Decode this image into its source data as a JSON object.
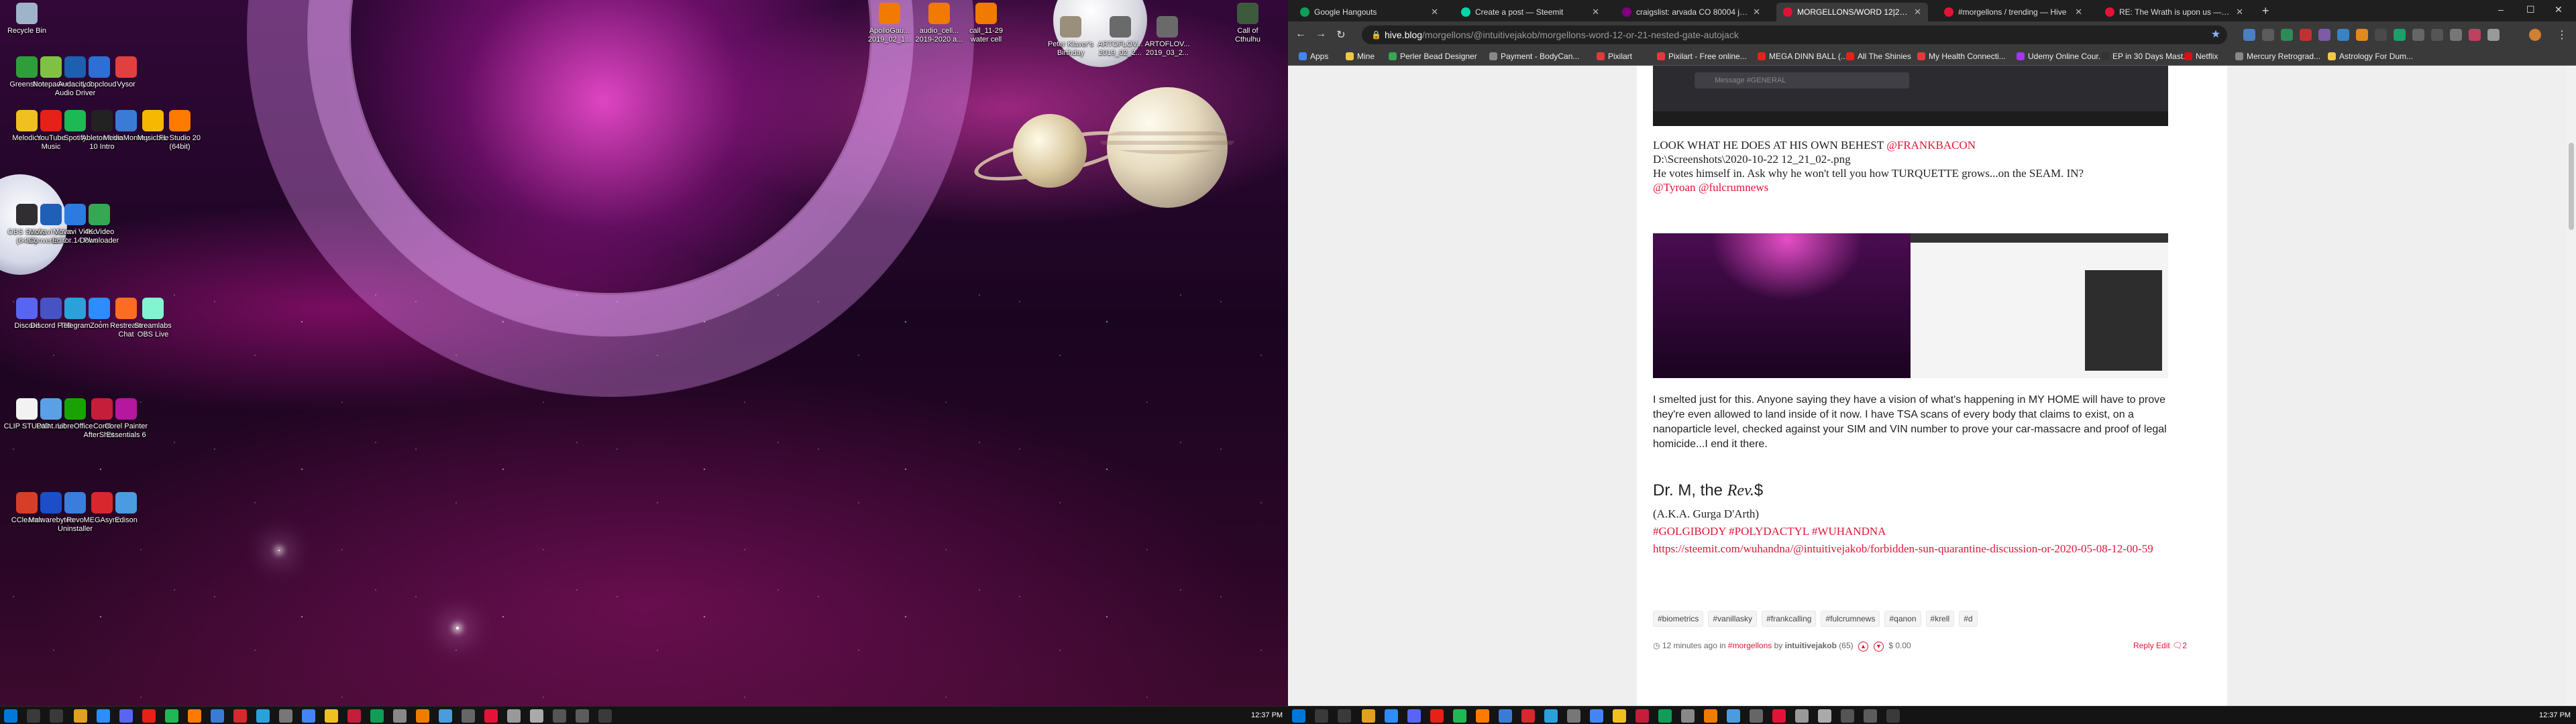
{
  "desktop_left": {
    "icons": [
      {
        "label": "Recycle Bin",
        "color": "#9fb4c8"
      },
      {
        "label": "Greenshot",
        "color": "#2e9e3a"
      },
      {
        "label": "Notepad++",
        "color": "#7fc243"
      },
      {
        "label": "Audacity 2 Audio Driver",
        "color": "#1e5fb0"
      },
      {
        "label": "Loopcloud",
        "color": "#2d6fd2"
      },
      {
        "label": "Vysor",
        "color": "#e04040"
      },
      {
        "label": "Melodics",
        "color": "#f0c020"
      },
      {
        "label": "YouTube Music",
        "color": "#e62117"
      },
      {
        "label": "Spotify",
        "color": "#1db954"
      },
      {
        "label": "Ableton Live 10 Intro",
        "color": "#222222"
      },
      {
        "label": "MediaMonkey",
        "color": "#3a7bd5"
      },
      {
        "label": "Musicbee",
        "color": "#f6b800"
      },
      {
        "label": "FL Studio 20 (64bit)",
        "color": "#ff7a00"
      },
      {
        "label": "OBS Studio (64bit)",
        "color": "#302e31"
      },
      {
        "label": "Movavi Video Converter 2...",
        "color": "#1f5fb8"
      },
      {
        "label": "Movavi Video Editor 14 Plus",
        "color": "#2b7be0"
      },
      {
        "label": "4K Video Downloader",
        "color": "#34a853"
      },
      {
        "label": "Discord",
        "color": "#5865f2"
      },
      {
        "label": "Discord PTB",
        "color": "#4752c4"
      },
      {
        "label": "Telegram",
        "color": "#2aa1da"
      },
      {
        "label": "Zoom",
        "color": "#2d8cff"
      },
      {
        "label": "Restream Chat",
        "color": "#fc6c21"
      },
      {
        "label": "Streamlabs OBS Live",
        "color": "#80f5d2"
      },
      {
        "label": "CLIP STUDIO",
        "color": "#f2f2f2"
      },
      {
        "label": "Paint.net",
        "color": "#5aa0e6"
      },
      {
        "label": "LibreOffice",
        "color": "#18a303"
      },
      {
        "label": "Corel AfterShot...",
        "color": "#c41e3a"
      },
      {
        "label": "Corel Painter Essentials 6",
        "color": "#b5179e"
      },
      {
        "label": "CCleaner",
        "color": "#d73e28"
      },
      {
        "label": "Malwarebytes",
        "color": "#1c4ec9"
      },
      {
        "label": "Revo Uninstaller",
        "color": "#3b7ddd"
      },
      {
        "label": "MEGAsync",
        "color": "#d9272e"
      },
      {
        "label": "Edison",
        "color": "#4a9be0"
      },
      {
        "label": "ApolloGau... 2019_02_1...",
        "color": "#f07b00"
      },
      {
        "label": "audio_cell... 2019-2020 a...",
        "color": "#f07b00"
      },
      {
        "label": "call_11-29 water cell",
        "color": "#f07b00"
      },
      {
        "label": "Peter Klaver's Birthday",
        "color": "#9a8f7a"
      },
      {
        "label": "ARTOFLOV... 2019_02_2...",
        "color": "#6a6a6a"
      },
      {
        "label": "ARTOFLOV... 2019_03_2...",
        "color": "#6a6a6a"
      },
      {
        "label": "Call of Cthulhu",
        "color": "#3d5a3d"
      }
    ]
  },
  "taskbar_left": {
    "clock": "12:37 PM"
  },
  "taskbar_right": {
    "clock": "12:37 PM"
  },
  "browser": {
    "tabs": [
      {
        "title": "Google Hangouts",
        "color": "#0f9d58",
        "active": false
      },
      {
        "title": "Create a post — Steemit",
        "color": "#07d7a9",
        "active": false
      },
      {
        "title": "craigslist: arvada CO 80004 jobs...",
        "color": "#800080",
        "active": false
      },
      {
        "title": "MORGELLONS/WORD 12|21 NE...",
        "color": "#e31337",
        "active": true
      },
      {
        "title": "#morgellons / trending — Hive",
        "color": "#e31337",
        "active": false
      },
      {
        "title": "RE: The Wrath is upon us — Hive",
        "color": "#e31337",
        "active": false
      }
    ],
    "url": {
      "host": "hive.blog",
      "path": "/morgellons/@intuitivejakob/morgellons-word-12-or-21-nested-gate-autojack"
    },
    "bookmarks": [
      {
        "label": "Apps",
        "color": "#4285f4"
      },
      {
        "label": "Mine",
        "color": "#f2c744"
      },
      {
        "label": "Perler Bead Designer",
        "color": "#34a853"
      },
      {
        "label": "Payment - BodyCan...",
        "color": "#888888"
      },
      {
        "label": "Pixilart",
        "color": "#e23a3a"
      },
      {
        "label": "Pixilart - Free online...",
        "color": "#e23a3a"
      },
      {
        "label": "MEGA DINN BALL (...",
        "color": "#e62117"
      },
      {
        "label": "All The Shinies",
        "color": "#e62117"
      },
      {
        "label": "My Health Connecti...",
        "color": "#e23a3a"
      },
      {
        "label": "Udemy Online Cour...",
        "color": "#a435f0"
      },
      {
        "label": "EP in 30 Days Mast...",
        "color": "#333333"
      },
      {
        "label": "Netflix",
        "color": "#e50914"
      },
      {
        "label": "Mercury Retrograd...",
        "color": "#888888"
      },
      {
        "label": "Astrology For Dum...",
        "color": "#f2c744"
      }
    ]
  },
  "post": {
    "message_placeholder": "Message #GENERAL",
    "line1_prefix": "LOOK WHAT HE DOES AT HIS OWN BEHEST ",
    "line1_mention": "@FRANKBACON",
    "line2": "D:\\Screenshots\\2020-10-22 12_21_02-.png",
    "line3": "He votes himself in. Ask why he won't tell you how TURQUETTE grows...on the SEAM. IN?",
    "line4_mention1": "@Tyroan",
    "line4_mention2": "@fulcrumnews",
    "paragraph": "I smelted just for this. Anyone saying they have a vision of what's happening in MY HOME will have to prove they're even allowed to land inside of it now. I have TSA scans of every body that claims to exist, on a nanoparticle level, checked against your SIM and VIN number to prove your car-massacre and proof of legal homicide...I end it there.",
    "sig_prefix": "Dr. M, the ",
    "sig_rev": "Rev.",
    "sig_suffix": "$",
    "aka": "(A.K.A. Gurga D'Arth)",
    "hashtags": "#GOLGIBODY #POLYDACTYL #WUHANDNA",
    "link": "https://steemit.com/wuhandna/@intuitivejakob/forbidden-sun-quarantine-discussion-or-2020-05-08-12-00-59",
    "tags": [
      "#biometrics",
      "#vanillasky",
      "#frankcalling",
      "#fulcrumnews",
      "#qanon",
      "#krell",
      "#d"
    ],
    "footer": {
      "time": "12 minutes ago in ",
      "community": "#morgellons",
      "by": " by ",
      "author": "intuitivejakob",
      "rep": "(65)",
      "payout": "$ 0.00",
      "reply": "Reply",
      "edit": "Edit",
      "comments": "2"
    }
  }
}
